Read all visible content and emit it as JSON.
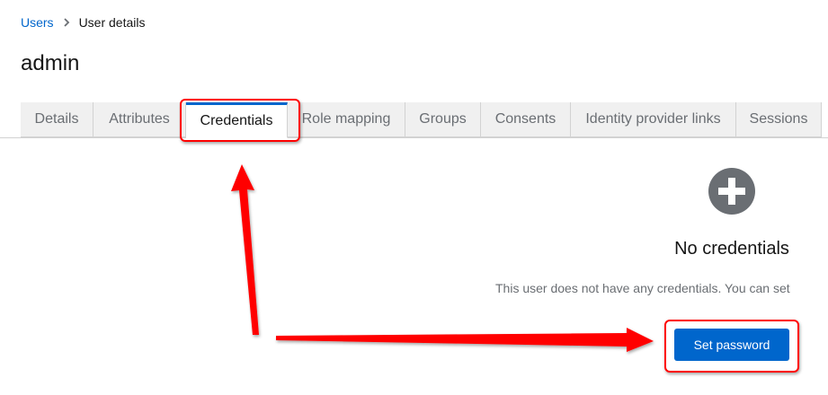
{
  "breadcrumb": {
    "items": [
      "Users",
      "User details"
    ]
  },
  "page": {
    "title": "admin"
  },
  "tabs": [
    {
      "label": "Details",
      "active": false
    },
    {
      "label": "Attributes",
      "active": false
    },
    {
      "label": "Credentials",
      "active": true
    },
    {
      "label": "Role mapping",
      "active": false
    },
    {
      "label": "Groups",
      "active": false
    },
    {
      "label": "Consents",
      "active": false
    },
    {
      "label": "Identity provider links",
      "active": false
    },
    {
      "label": "Sessions",
      "active": false
    }
  ],
  "empty_state": {
    "icon": "plus-circle-icon",
    "title": "No credentials",
    "body": "This user does not have any credentials. You can set",
    "action_label": "Set password"
  },
  "colors": {
    "accent": "#0066cc",
    "annotation": "#ff0000",
    "icon_gray": "#6a6e73"
  }
}
